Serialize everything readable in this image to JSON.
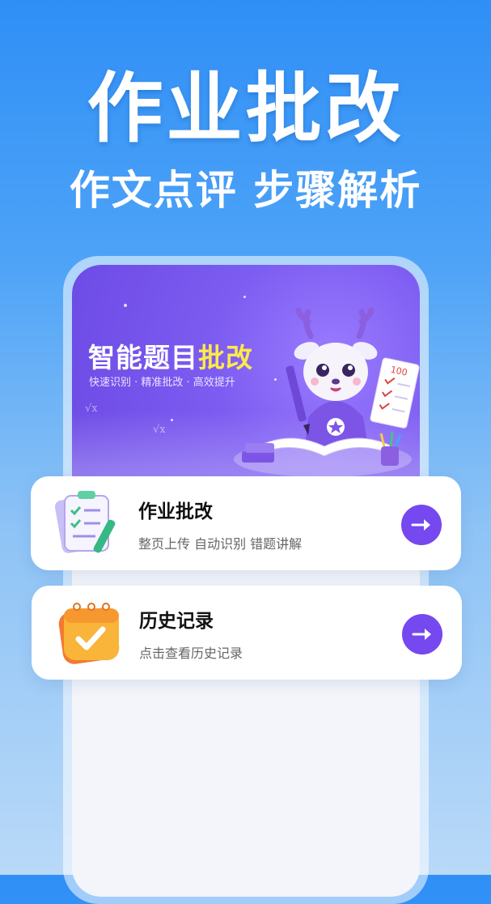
{
  "hero": {
    "title": "作业批改",
    "subtitle": "作文点评 步骤解析"
  },
  "banner": {
    "title_main": "智能题目",
    "title_highlight": "批改",
    "features": "快速识别 · 精准批改 · 高效提升",
    "paper_score": "100",
    "math_symbol": "√x"
  },
  "cards": [
    {
      "title": "作业批改",
      "desc": "整页上传  自动识别  错题讲解",
      "icon": "homework-clipboard-icon"
    },
    {
      "title": "历史记录",
      "desc": "点击查看历史记录",
      "icon": "calendar-check-icon"
    }
  ],
  "colors": {
    "accent": "#7548f0",
    "banner": "#7d5cf1",
    "highlight": "#ffe94a",
    "background_top": "#2f8ff6"
  }
}
